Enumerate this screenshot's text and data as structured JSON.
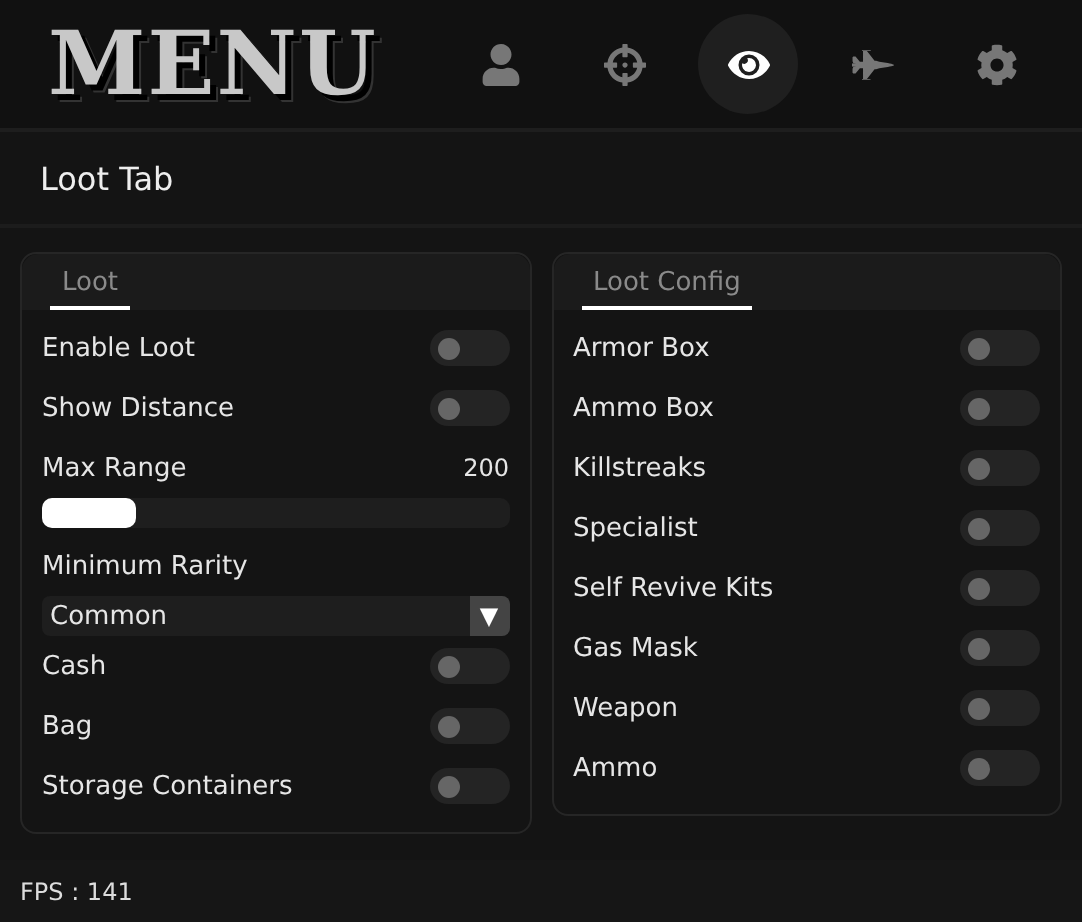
{
  "logo": "MENU",
  "nav_tabs": [
    {
      "selected": false
    },
    {
      "selected": false
    },
    {
      "selected": true
    },
    {
      "selected": false
    },
    {
      "selected": false
    }
  ],
  "page_title": "Loot Tab",
  "panels": [
    {
      "tab": "Loot",
      "items": [
        {
          "kind": "toggle",
          "label": "Enable Loot",
          "on": false
        },
        {
          "kind": "toggle",
          "label": "Show Distance",
          "on": false
        },
        {
          "kind": "slider",
          "label": "Max Range",
          "reading": "200",
          "level": 0.2
        },
        {
          "kind": "dropdown",
          "label": "Minimum Rarity",
          "value": "Common",
          "arrow": "▼"
        },
        {
          "kind": "toggle",
          "label": "Cash",
          "on": false
        },
        {
          "kind": "toggle",
          "label": "Bag",
          "on": false
        },
        {
          "kind": "toggle",
          "label": "Storage Containers",
          "on": false
        }
      ]
    },
    {
      "tab": "Loot Config",
      "items": [
        {
          "kind": "toggle",
          "label": "Armor Box",
          "on": false
        },
        {
          "kind": "toggle",
          "label": "Ammo Box",
          "on": false
        },
        {
          "kind": "toggle",
          "label": "Killstreaks",
          "on": false
        },
        {
          "kind": "toggle",
          "label": "Specialist",
          "on": false
        },
        {
          "kind": "toggle",
          "label": "Self Revive Kits",
          "on": false
        },
        {
          "kind": "toggle",
          "label": "Gas Mask",
          "on": false
        },
        {
          "kind": "toggle",
          "label": "Weapon",
          "on": false
        },
        {
          "kind": "toggle",
          "label": "Ammo",
          "on": false
        }
      ]
    }
  ],
  "status_bar": "FPS : 141"
}
